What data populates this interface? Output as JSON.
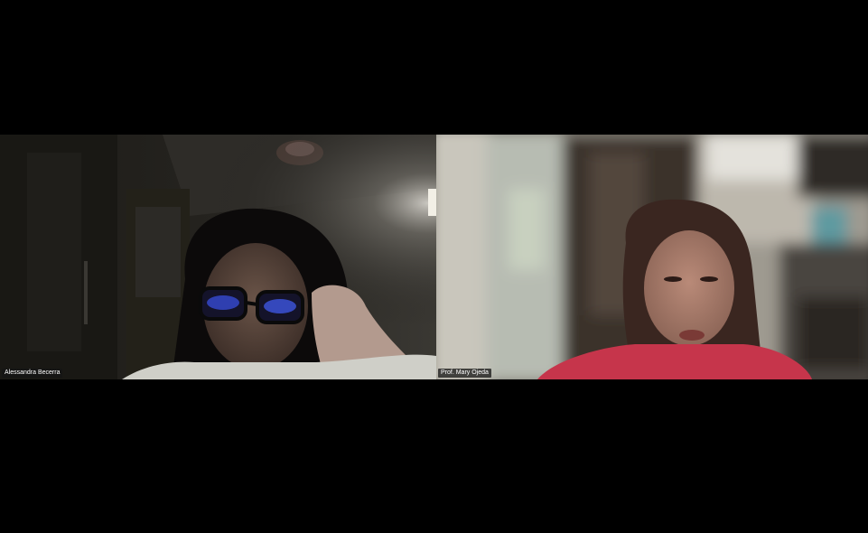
{
  "participants": [
    {
      "name": "Alessandra Becerra"
    },
    {
      "name": "Prof. Mary Ojeda"
    }
  ],
  "colors": {
    "background": "#000000",
    "name_tag_bg": "#141414",
    "name_tag_text": "#ffffff"
  }
}
